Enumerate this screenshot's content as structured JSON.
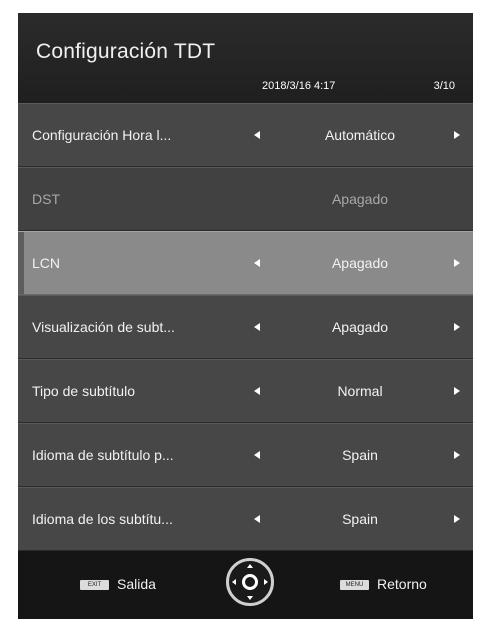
{
  "header": {
    "title": "Configuración TDT",
    "datetime": "2018/3/16 4:17",
    "page_indicator": "3/10"
  },
  "menu": {
    "items": [
      {
        "label": "Configuración Hora l...",
        "value": "Automático"
      },
      {
        "label": "DST",
        "value": "Apagado"
      },
      {
        "label": "LCN",
        "value": "Apagado"
      },
      {
        "label": "Visualización de subt...",
        "value": "Apagado"
      },
      {
        "label": "Tipo de subtítulo",
        "value": "Normal"
      },
      {
        "label": "Idioma de subtítulo p...",
        "value": "Spain"
      },
      {
        "label": "Idioma de los subtítu...",
        "value": "Spain"
      }
    ]
  },
  "footer": {
    "exit_key": "EXIT",
    "exit_label": "Salida",
    "menu_key": "MENU",
    "return_label": "Retorno"
  },
  "icons": {
    "left_arrow": "left-arrow-icon",
    "right_arrow": "right-arrow-icon",
    "dpad": "dpad-icon"
  }
}
